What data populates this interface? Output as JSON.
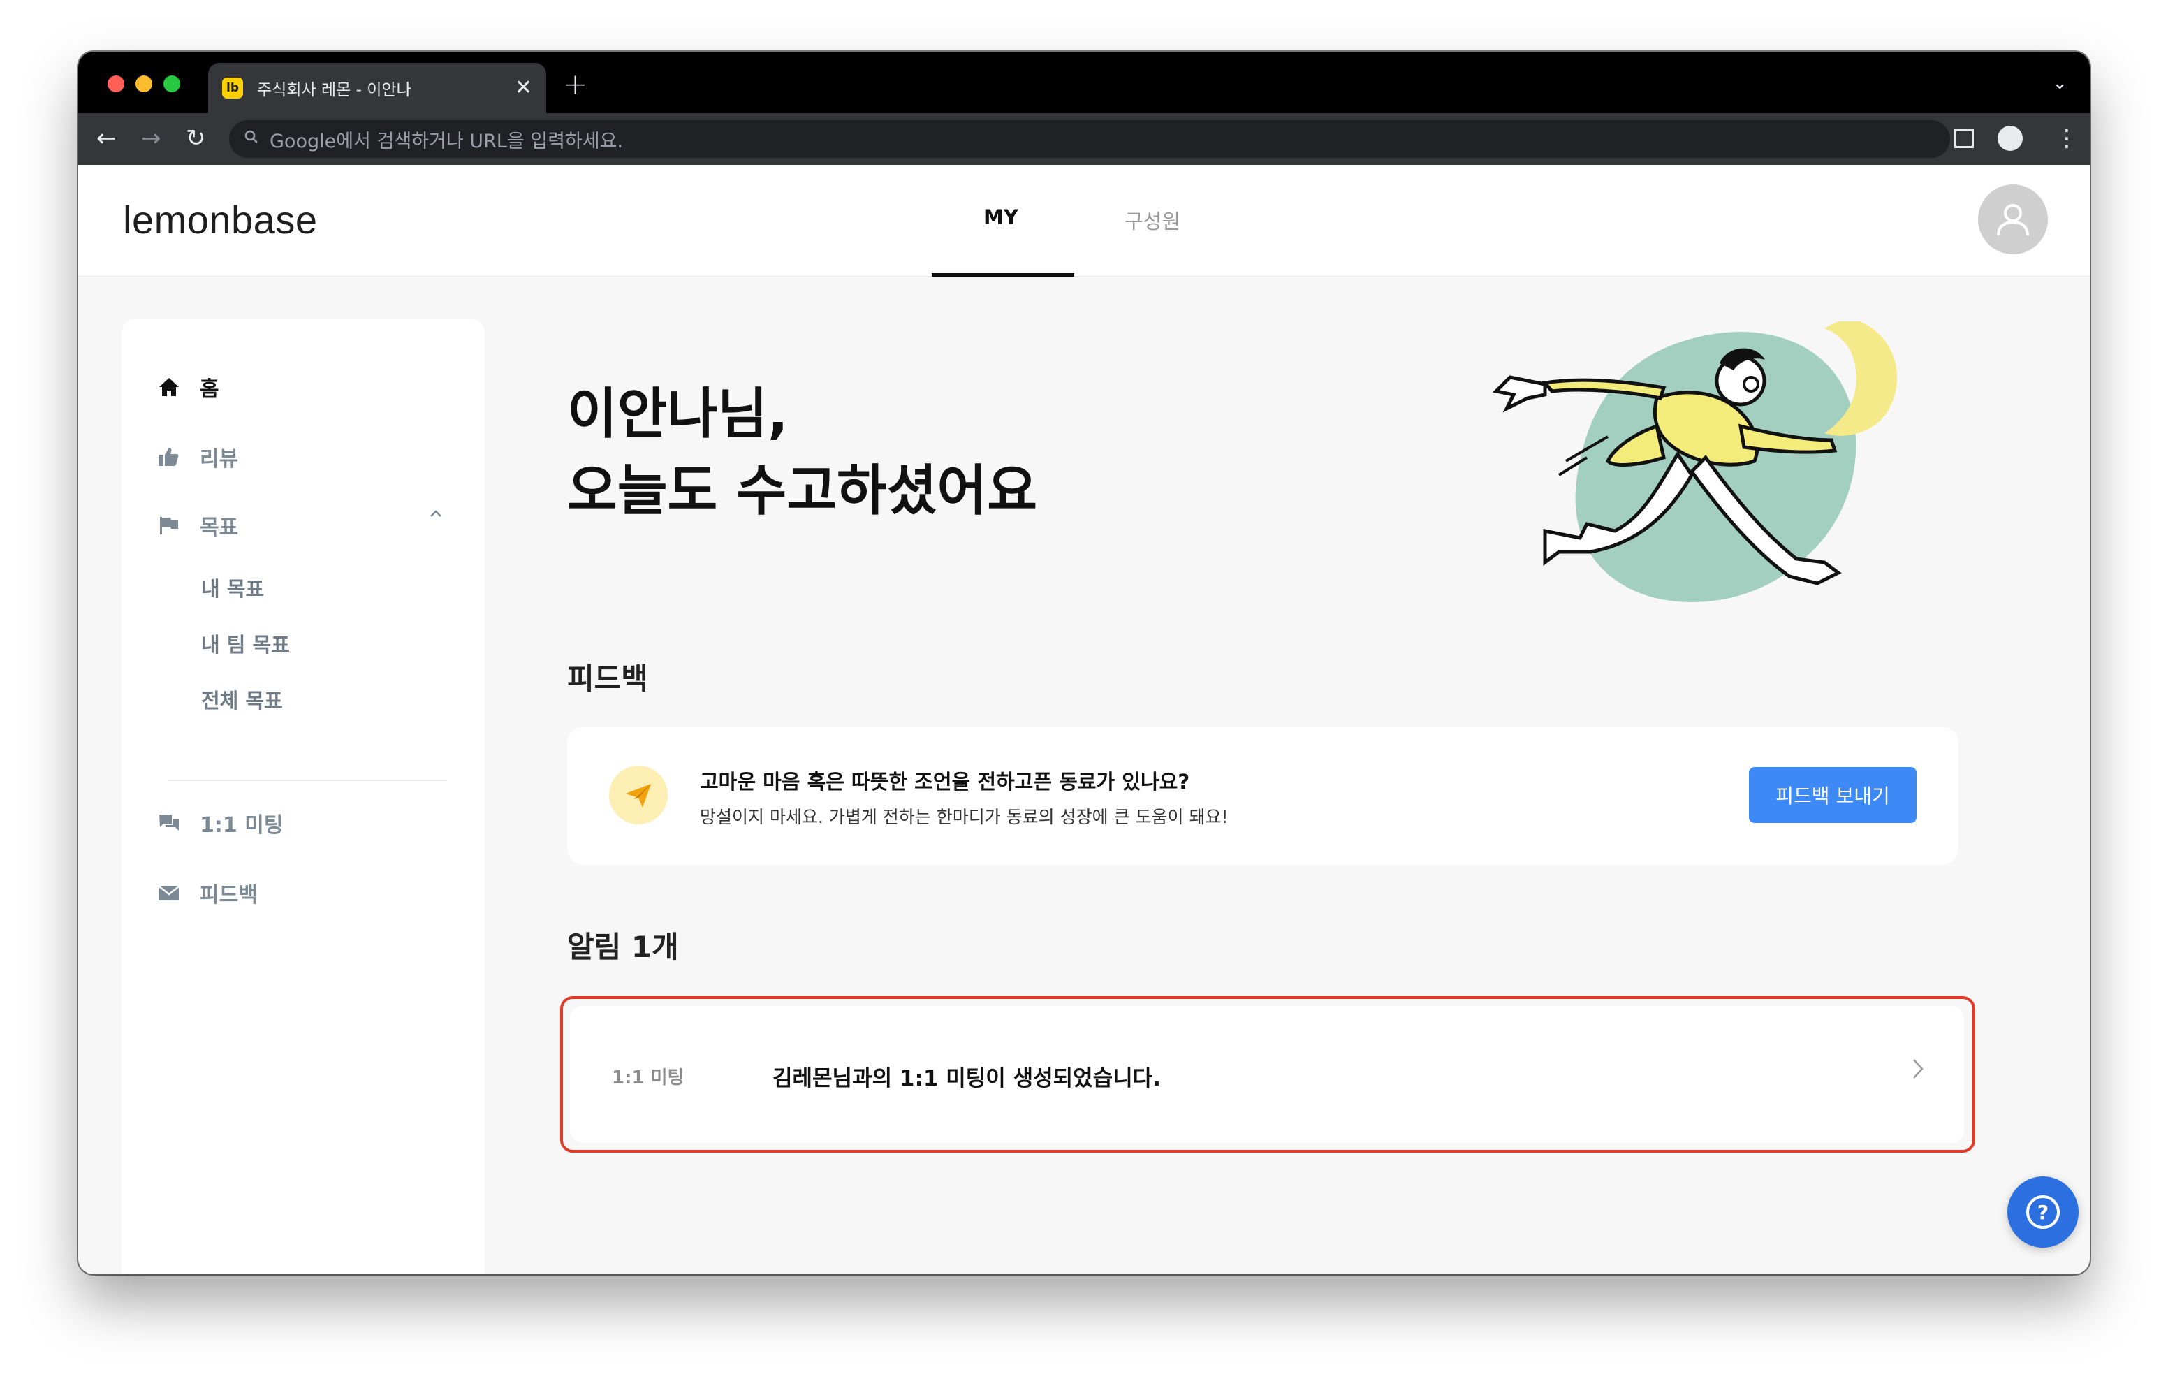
{
  "browser": {
    "tab_favicon": "lb",
    "tab_title": "주식회사 레몬 - 이안나",
    "tab_close": "✕",
    "new_tab": "+",
    "address_placeholder": "Google에서 검색하거나 URL을 입력하세요."
  },
  "header": {
    "logo": "lemonbase",
    "tabs": [
      {
        "label": "MY",
        "active": true
      },
      {
        "label": "구성원",
        "active": false
      }
    ]
  },
  "sidebar": {
    "items": [
      {
        "label": "홈",
        "icon": "home-icon",
        "active": true
      },
      {
        "label": "리뷰",
        "icon": "thumbs-up-icon",
        "active": false
      },
      {
        "label": "목표",
        "icon": "flag-icon",
        "active": false,
        "expanded": true
      },
      {
        "label": "1:1 미팅",
        "icon": "chat-icon",
        "active": false
      },
      {
        "label": "피드백",
        "icon": "mail-icon",
        "active": false
      }
    ],
    "goal_subitems": [
      "내 목표",
      "내 팀 목표",
      "전체 목표"
    ]
  },
  "main": {
    "greeting_line1": "이안나님,",
    "greeting_line2": "오늘도 수고하셨어요",
    "feedback_section_title": "피드백",
    "feedback_card": {
      "title": "고마운 마음 혹은 따뜻한 조언을 전하고픈 동료가 있나요?",
      "subtitle": "망설이지 마세요. 가볍게 전하는 한마디가 동료의 성장에 큰 도움이 돼요!",
      "button_label": "피드백 보내기"
    },
    "notification_section_title": "알림 1개",
    "notifications": [
      {
        "category": "1:1 미팅",
        "text": "김레몬님과의 1:1 미팅이 생성되었습니다."
      }
    ]
  },
  "help_button": "?",
  "colors": {
    "accent_blue": "#3d8af7",
    "highlight_red": "#e23a26",
    "illustration_green": "#a3cfc0",
    "illustration_yellow": "#f4ea8a"
  }
}
